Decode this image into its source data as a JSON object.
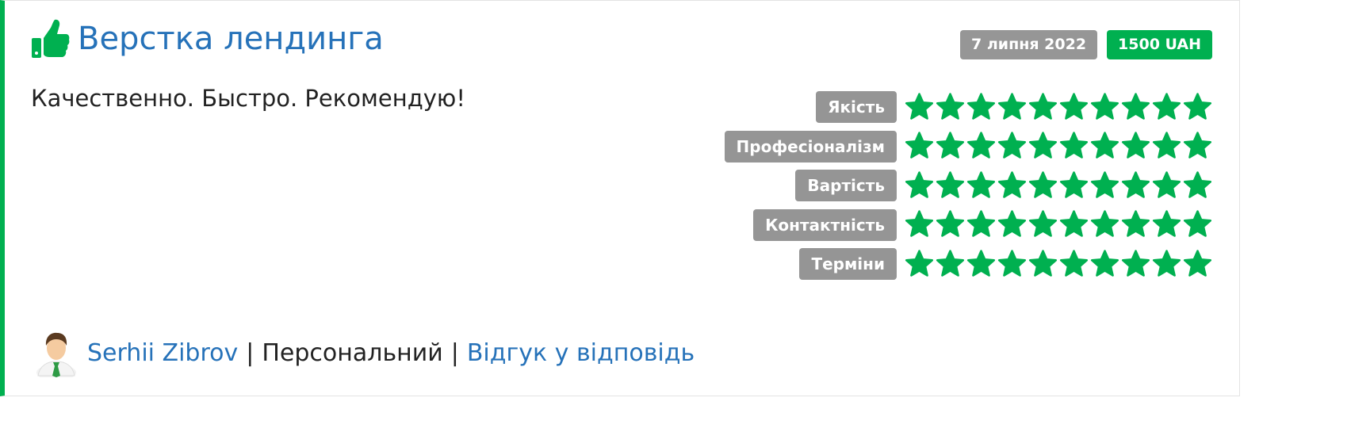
{
  "review": {
    "title": "Верстка лендинга",
    "date": "7 липня 2022",
    "price": "1500 UAH",
    "comment": "Качественно. Быстро. Рекомендую!",
    "icon": "thumbs-up-icon",
    "colors": {
      "accent": "#00b050",
      "link": "#2672b9",
      "badge_gray": "#969696"
    }
  },
  "ratings": [
    {
      "label": "Якість",
      "score": 10,
      "max": 10
    },
    {
      "label": "Професіоналізм",
      "score": 10,
      "max": 10
    },
    {
      "label": "Вартість",
      "score": 10,
      "max": 10
    },
    {
      "label": "Контактність",
      "score": 10,
      "max": 10
    },
    {
      "label": "Терміни",
      "score": 10,
      "max": 10
    }
  ],
  "footer": {
    "author": "Serhii Zibrov",
    "type": "Персональний",
    "reply_link": "Відгук у відповідь",
    "separator": "|",
    "avatar_icon": "user-avatar-icon"
  }
}
